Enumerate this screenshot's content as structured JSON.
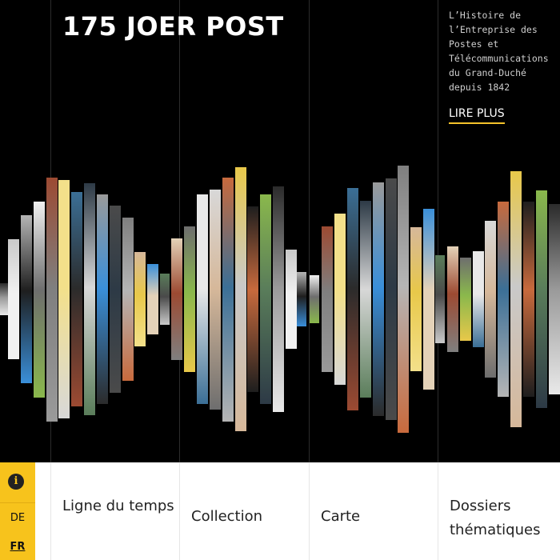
{
  "header": {
    "title": "175 JOER POST"
  },
  "intro": {
    "lines": [
      "L’Histoire de",
      "l’Entreprise des",
      "Postes et",
      "Télécommunications",
      "du Grand-Duché",
      "depuis 1842"
    ],
    "read_more_label": "LIRE PLUS"
  },
  "colors": {
    "accent": "#f7c31c",
    "background": "#000000",
    "nav_background": "#ffffff"
  },
  "side_panel": {
    "info_icon": "info-icon",
    "languages": [
      "DE",
      "FR"
    ],
    "active_language": "FR"
  },
  "nav": {
    "timeline": "Ligne du temps",
    "collection": "Collection",
    "map": "Carte",
    "dossiers": "Dossiers thématiques"
  },
  "strips": {
    "description_images": "vertical photo strips arranged as an audio waveform",
    "palette": [
      "#2b2b2b",
      "#6e6e6e",
      "#9a9a9a",
      "#c9c9c9",
      "#e9e9e9",
      "#4a4a4a",
      "#b5b5b5",
      "#d8d8d8",
      "#7f7f7f",
      "#f1f1f1",
      "#c86a3d",
      "#d6b89a",
      "#9c4a32",
      "#e8c84a",
      "#3a8fd9",
      "#f3e08a",
      "#1e1e1e",
      "#5a7d5a",
      "#3b6f96",
      "#8ab84c",
      "#e4d2b8",
      "#2d3a46"
    ]
  }
}
